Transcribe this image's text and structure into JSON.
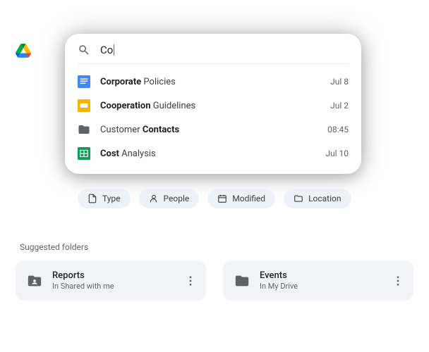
{
  "search": {
    "query": "Co"
  },
  "results": [
    {
      "icon": "docs",
      "prefix": "Corporate",
      "rest": " Policies",
      "date": "Jul 8"
    },
    {
      "icon": "slides",
      "prefix": "Cooperation",
      "rest": " Guidelines",
      "date": "Jul 2"
    },
    {
      "icon": "folder",
      "prefix": "",
      "rest": "Customer ",
      "suffix": "Contacts",
      "date": "08:45"
    },
    {
      "icon": "sheets",
      "prefix": "Cost",
      "rest": " Analysis",
      "date": "Jul 10"
    }
  ],
  "chips": [
    {
      "icon": "type",
      "label": "Type"
    },
    {
      "icon": "people",
      "label": "People"
    },
    {
      "icon": "modified",
      "label": "Modified"
    },
    {
      "icon": "location",
      "label": "Location"
    }
  ],
  "suggested_label": "Suggested folders",
  "folders": [
    {
      "icon": "shared-folder",
      "name": "Reports",
      "location": "In Shared with me"
    },
    {
      "icon": "folder",
      "name": "Events",
      "location": "In My Drive"
    }
  ]
}
